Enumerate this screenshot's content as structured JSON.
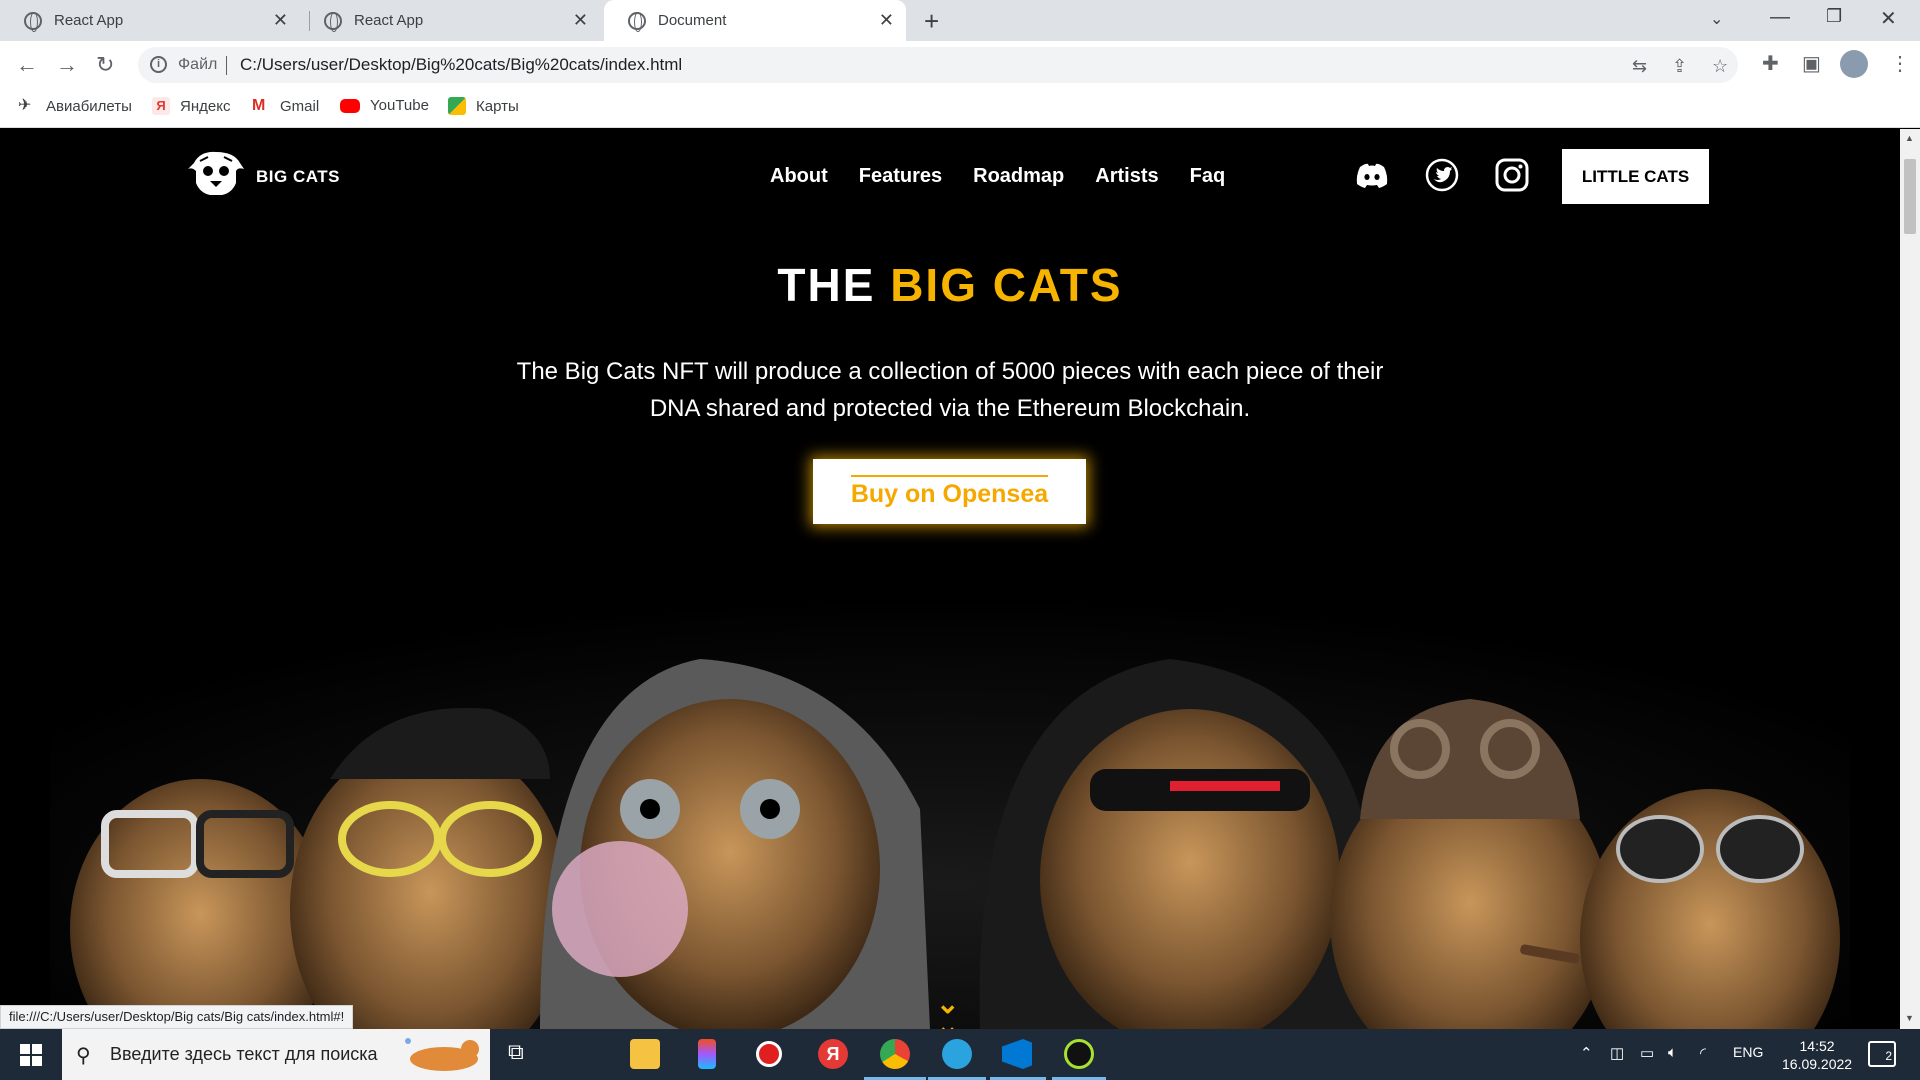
{
  "browser": {
    "tabs": [
      {
        "title": "React App"
      },
      {
        "title": "React App"
      },
      {
        "title": "Document"
      }
    ],
    "file_label": "Файл",
    "url": "C:/Users/user/Desktop/Big%20cats/Big%20cats/index.html",
    "bookmarks": [
      {
        "label": "Авиабилеты",
        "color": "#222222"
      },
      {
        "label": "Яндекс",
        "color": "#e53935"
      },
      {
        "label": "Gmail",
        "color": "#d93025"
      },
      {
        "label": "YouTube",
        "color": "#ff0000"
      },
      {
        "label": "Карты",
        "color": "#34a853"
      }
    ],
    "status_url": "file:///C:/Users/user/Desktop/Big cats/Big cats/index.html#!"
  },
  "site": {
    "logo_text": "BIG CATS",
    "nav": [
      "About",
      "Features",
      "Roadmap",
      "Artists",
      "Faq"
    ],
    "social": [
      "discord-icon",
      "twitter-icon",
      "instagram-icon"
    ],
    "cta_header": "LITTLE CATS",
    "hero_title_white": "THE",
    "hero_title_accent": "BIG CATS",
    "hero_description": "The Big Cats NFT will produce a collection of 5000 pieces with each piece of their DNA shared and protected via the Ethereum Blockchain.",
    "hero_button": "Buy on Opensea",
    "accent_color": "#f6b300"
  },
  "taskbar": {
    "search_placeholder": "Введите здесь текст для поиска",
    "language": "ENG",
    "time": "14:52",
    "date": "16.09.2022",
    "notifications": "2"
  }
}
